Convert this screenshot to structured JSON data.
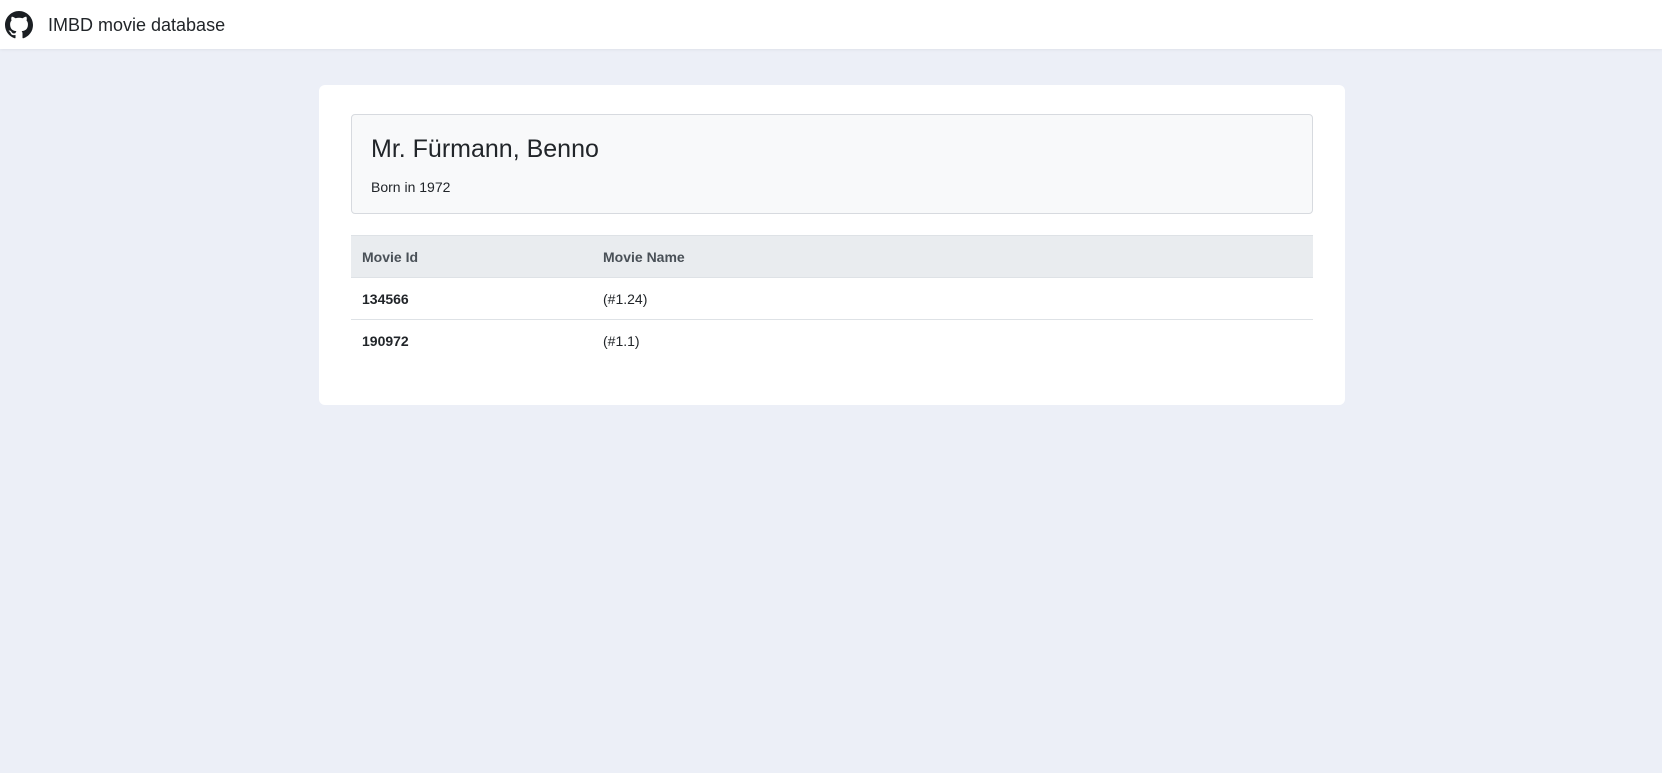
{
  "navbar": {
    "title": "IMBD movie database",
    "logo_icon": "github-icon"
  },
  "person": {
    "name": "Mr. Fürmann, Benno",
    "born": "Born in 1972"
  },
  "movies_table": {
    "headers": [
      "Movie Id",
      "Movie Name"
    ],
    "rows": [
      {
        "id": "134566",
        "name": "(#1.24)"
      },
      {
        "id": "190972",
        "name": "(#1.1)"
      }
    ]
  },
  "colors": {
    "page_background": "#eceff7",
    "card_background": "#ffffff",
    "jumbotron_background": "#f8f9fa",
    "table_header_background": "#e9ecef"
  }
}
